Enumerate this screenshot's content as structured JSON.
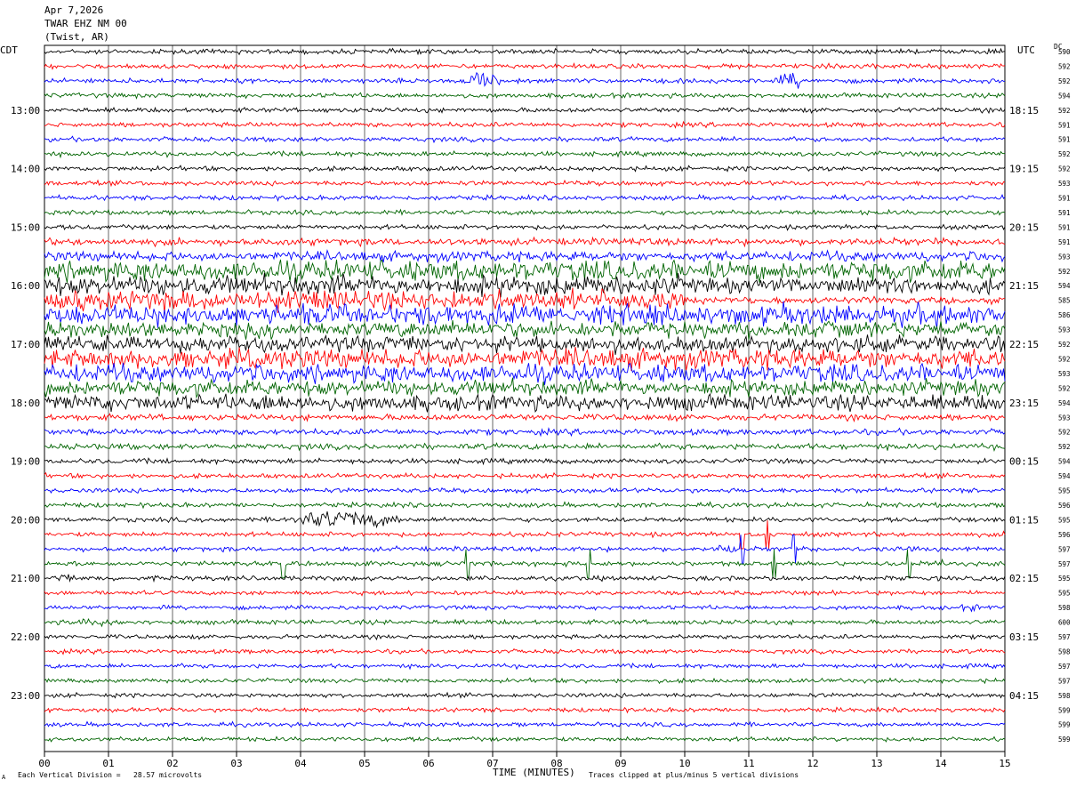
{
  "header": {
    "date": "Apr 7,2026",
    "station": "TWAR EHZ NM 00",
    "location": "(Twist, AR)"
  },
  "left_axis_label": "CDT",
  "right_axis_label": "UTC",
  "dc_label": "DC",
  "xlabel": "TIME (MINUTES)",
  "footer": {
    "marker": "A",
    "scale": "Each Vertical Division =   28.57 microvolts",
    "clip": "Traces clipped at plus/minus 5 vertical divisions"
  },
  "colors": {
    "black": "#000000",
    "red": "#ff0000",
    "blue": "#0000ff",
    "green": "#006400"
  },
  "chart_data": {
    "type": "line",
    "title": "",
    "xlim": [
      0,
      15
    ],
    "x_ticks": [
      "00",
      "01",
      "02",
      "03",
      "04",
      "05",
      "06",
      "07",
      "08",
      "09",
      "10",
      "11",
      "12",
      "13",
      "14",
      "15"
    ],
    "trace_count": 48,
    "color_cycle": [
      "#000000",
      "#ff0000",
      "#0000ff",
      "#006400"
    ],
    "left_time_labels": [
      {
        "trace": 4,
        "label": "13:00"
      },
      {
        "trace": 8,
        "label": "14:00"
      },
      {
        "trace": 12,
        "label": "15:00"
      },
      {
        "trace": 16,
        "label": "16:00"
      },
      {
        "trace": 20,
        "label": "17:00"
      },
      {
        "trace": 24,
        "label": "18:00"
      },
      {
        "trace": 28,
        "label": "19:00"
      },
      {
        "trace": 32,
        "label": "20:00"
      },
      {
        "trace": 36,
        "label": "21:00"
      },
      {
        "trace": 40,
        "label": "22:00"
      },
      {
        "trace": 44,
        "label": "23:00"
      }
    ],
    "right_time_labels": [
      {
        "trace": 4,
        "label": "18:15"
      },
      {
        "trace": 8,
        "label": "19:15"
      },
      {
        "trace": 12,
        "label": "20:15"
      },
      {
        "trace": 16,
        "label": "21:15"
      },
      {
        "trace": 20,
        "label": "22:15"
      },
      {
        "trace": 24,
        "label": "23:15"
      },
      {
        "trace": 28,
        "label": "00:15"
      },
      {
        "trace": 32,
        "label": "01:15"
      },
      {
        "trace": 36,
        "label": "02:15"
      },
      {
        "trace": 40,
        "label": "03:15"
      },
      {
        "trace": 44,
        "label": "04:15"
      }
    ],
    "dc_values": [
      "590",
      "592",
      "592",
      "594",
      "592",
      "591",
      "591",
      "592",
      "592",
      "593",
      "591",
      "591",
      "591",
      "591",
      "593",
      "592",
      "594",
      "585",
      "586",
      "593",
      "592",
      "592",
      "593",
      "592",
      "594",
      "593",
      "592",
      "592",
      "594",
      "594",
      "595",
      "596",
      "595",
      "596",
      "597",
      "597",
      "595",
      "595",
      "598",
      "600",
      "597",
      "598",
      "597",
      "597",
      "598",
      "599",
      "599",
      "599"
    ],
    "trace_amplitude": [
      1.2,
      1.2,
      1.2,
      1.2,
      1.2,
      1.2,
      1.2,
      1.2,
      1.2,
      1.2,
      1.2,
      1.2,
      1.2,
      1.8,
      2.5,
      5,
      5,
      5,
      5,
      4,
      4,
      5,
      4.5,
      4,
      4,
      1.6,
      1.5,
      1.5,
      1.3,
      1.2,
      1.2,
      1.2,
      1.2,
      1.2,
      1.2,
      1.2,
      1.2,
      1.1,
      1.1,
      1.2,
      1.1,
      1.1,
      1.1,
      1.1,
      1.1,
      1.1,
      1.1,
      1.1
    ],
    "events": [
      {
        "trace": 2,
        "start": 6.5,
        "end": 7.6,
        "amplitude": 5
      },
      {
        "trace": 2,
        "start": 11.4,
        "end": 12.2,
        "amplitude": 5
      },
      {
        "trace": 19,
        "start": 5.6,
        "end": 6.6,
        "amplitude": 5
      },
      {
        "trace": 24,
        "start": 2.5,
        "end": 6.2,
        "amplitude": 5
      },
      {
        "trace": 32,
        "start": 3.5,
        "end": 7.2,
        "amplitude": 5
      },
      {
        "trace": 36,
        "start": 0.0,
        "end": 1.0,
        "amplitude": 3
      },
      {
        "trace": 34,
        "start": 10.4,
        "end": 11.2,
        "amplitude": 3
      },
      {
        "trace": 35,
        "start": 13.4,
        "end": 15.0,
        "amplitude": 2
      },
      {
        "trace": 38,
        "start": 14.2,
        "end": 15.0,
        "amplitude": 2
      },
      {
        "trace": 39,
        "start": 0.0,
        "end": 2.6,
        "amplitude": 2
      }
    ],
    "spikes": [
      {
        "trace": 35,
        "x": 3.72
      },
      {
        "trace": 35,
        "x": 6.6
      },
      {
        "trace": 35,
        "x": 8.5
      },
      {
        "trace": 34,
        "x": 10.9
      },
      {
        "trace": 34,
        "x": 11.7
      },
      {
        "trace": 35,
        "x": 11.4
      },
      {
        "trace": 35,
        "x": 13.5
      },
      {
        "trace": 33,
        "x": 10.9
      },
      {
        "trace": 33,
        "x": 11.3
      }
    ]
  }
}
